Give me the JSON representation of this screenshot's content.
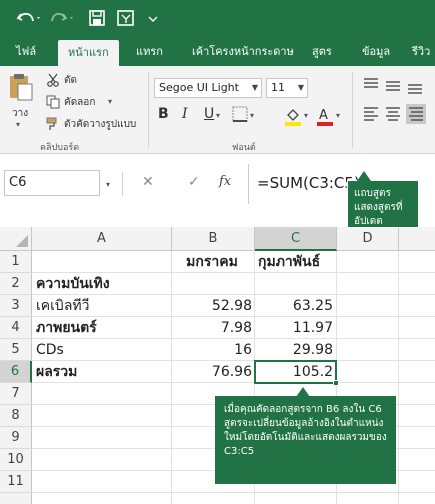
{
  "ribbon_tabs": {
    "file": "ไฟล์",
    "home": "หน้าแรก",
    "insert": "แทรก",
    "page_layout": "เค้าโครงหน้ากระดาษ",
    "formulas": "สูตร",
    "data": "ข้อมูล",
    "review": "รีวิว"
  },
  "clipboard": {
    "paste": "วาง",
    "cut": "ตัด",
    "copy": "คัดลอก",
    "format_painter": "ตัวคัดวางรูปแบบ",
    "group_label": "คลิปบอร์ด"
  },
  "font": {
    "name": "Segoe UI Light",
    "size": "11",
    "bold": "B",
    "italic": "I",
    "underline": "U",
    "group_label": "ฟอนต์",
    "fill_color": "#ffe600",
    "font_color": "#e02020"
  },
  "formula_bar": {
    "name_box": "C6",
    "cancel": "✕",
    "enter": "✓",
    "fx": "fx",
    "formula": "=SUM(C3:C5)"
  },
  "columns": [
    "A",
    "B",
    "C",
    "D"
  ],
  "rows": [
    "1",
    "2",
    "3",
    "4",
    "5",
    "6",
    "7",
    "8",
    "9",
    "10",
    "11"
  ],
  "cells": {
    "B1": "มกราคม",
    "C1": "กุมภาพันธ์",
    "A2": "ความบันเทิง",
    "A3": "เคเบิลทีวี",
    "B3": "52.98",
    "C3": "63.25",
    "A4": "ภาพยนตร์",
    "B4": "7.98",
    "C4": "11.97",
    "A5": "CDs",
    "B5": "16",
    "C5": "29.98",
    "A6": "ผลรวม",
    "B6": "76.96",
    "C6": "105.2"
  },
  "callouts": {
    "formula_bar_note": "แถบสูตรแสดงสูตรที่อัปเดต",
    "copy_note": "เมื่อคุณคัดลอกสูตรจาก B6 ลงใน C6 สูตรจะเปลี่ยนข้อมูลอ้างอิงในตำแหน่งใหม่โดยอัตโนมัติและแสดงผลรวมของ C3:C5"
  },
  "colors": {
    "accent": "#217346",
    "selection": "#217346"
  }
}
